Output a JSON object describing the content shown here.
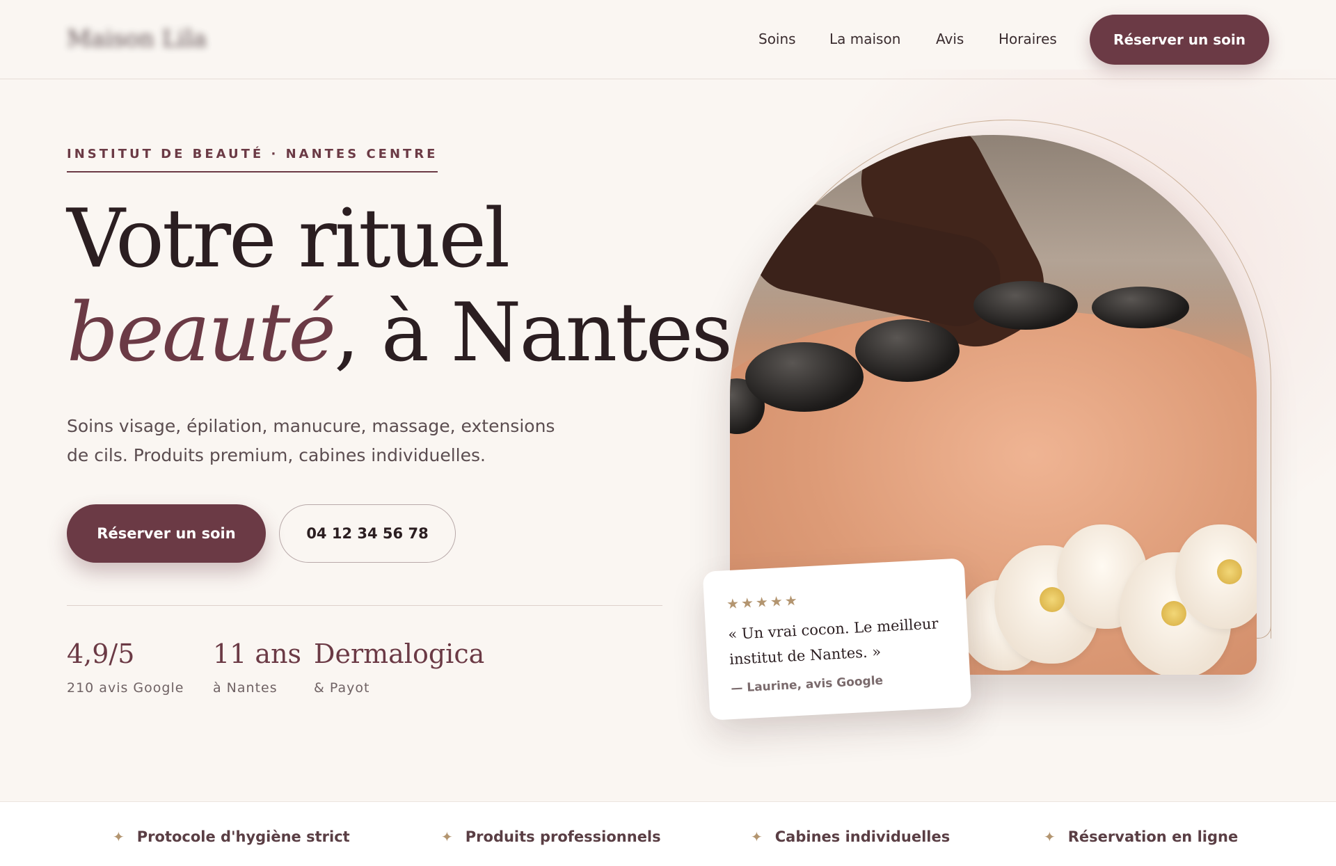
{
  "header": {
    "logo_text": "Maison Lila",
    "nav": [
      "Soins",
      "La maison",
      "Avis",
      "Horaires"
    ],
    "cta_label": "Réserver un soin"
  },
  "hero": {
    "eyebrow": "INSTITUT DE BEAUTÉ · NANTES CENTRE",
    "title_line1": "Votre rituel",
    "title_em": "beauté",
    "title_line2_rest": ", à Nantes.",
    "lede": "Soins visage, épilation, manucure, massage, extensions de cils. Produits premium, cabines individuelles.",
    "primary_cta": "Réserver un soin",
    "phone": "04 12 34 56 78",
    "stats": [
      {
        "value": "4,9/5",
        "label": "210 avis Google"
      },
      {
        "value": "11 ans",
        "label": "à Nantes"
      },
      {
        "value": "Dermalogica",
        "label": "& Payot"
      }
    ]
  },
  "review": {
    "stars": "★★★★★",
    "rating": 5,
    "quote": "« Un vrai cocon. Le meilleur institut de Nantes. »",
    "author": "— Laurine, avis Google"
  },
  "features": [
    {
      "icon": "sparkle-icon",
      "label": "Protocole d'hygiène strict"
    },
    {
      "icon": "sparkle-icon",
      "label": "Produits professionnels"
    },
    {
      "icon": "sparkle-icon",
      "label": "Cabines individuelles"
    },
    {
      "icon": "sparkle-icon",
      "label": "Réservation en ligne"
    }
  ],
  "colors": {
    "background": "#faf6f2",
    "accent": "#6b3a45",
    "gold": "#b39570",
    "text": "#2b1e21"
  }
}
